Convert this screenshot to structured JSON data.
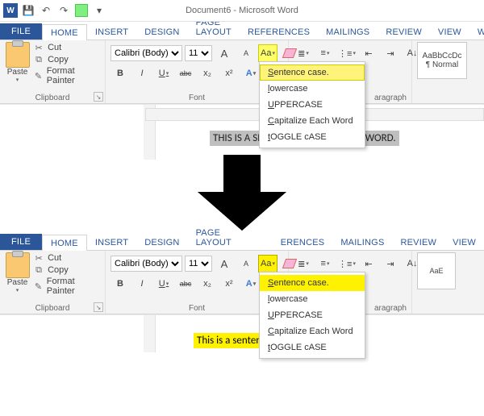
{
  "title": "Document6 - Microsoft Word",
  "tabs": {
    "file": "FILE",
    "home": "HOME",
    "insert": "INSERT",
    "design": "DESIGN",
    "pagelayout": "PAGE LAYOUT",
    "references": "REFERENCES",
    "mailings": "MAILINGS",
    "review": "REVIEW",
    "view": "VIEW",
    "worldox": "WORLDOX"
  },
  "clipboard": {
    "paste": "Paste",
    "cut": "Cut",
    "copy": "Copy",
    "formatpainter": "Format Painter",
    "label": "Clipboard"
  },
  "font": {
    "name": "Calibri (Body)",
    "size": "11",
    "grow": "A",
    "shrink": "A",
    "case": "Aa",
    "bold": "B",
    "italic": "I",
    "underline": "U",
    "strike": "abc",
    "sub": "x₂",
    "sup": "x²",
    "effects": "A",
    "label": "Font"
  },
  "case_menu": {
    "sentence": "Sentence case.",
    "lower": "lowercase",
    "upper": "UPPERCASE",
    "cap": "Capitalize Each Word",
    "toggle": "tOGGLE cASE"
  },
  "paragraph": {
    "label": "aragraph"
  },
  "styles": {
    "preview": "AaBbCcDc",
    "name": "¶ Normal"
  },
  "document": {
    "before": "THIS IS A SENTENCE IN MICROSOFT WORD.",
    "after": "This is a sentence in microsoft word."
  }
}
